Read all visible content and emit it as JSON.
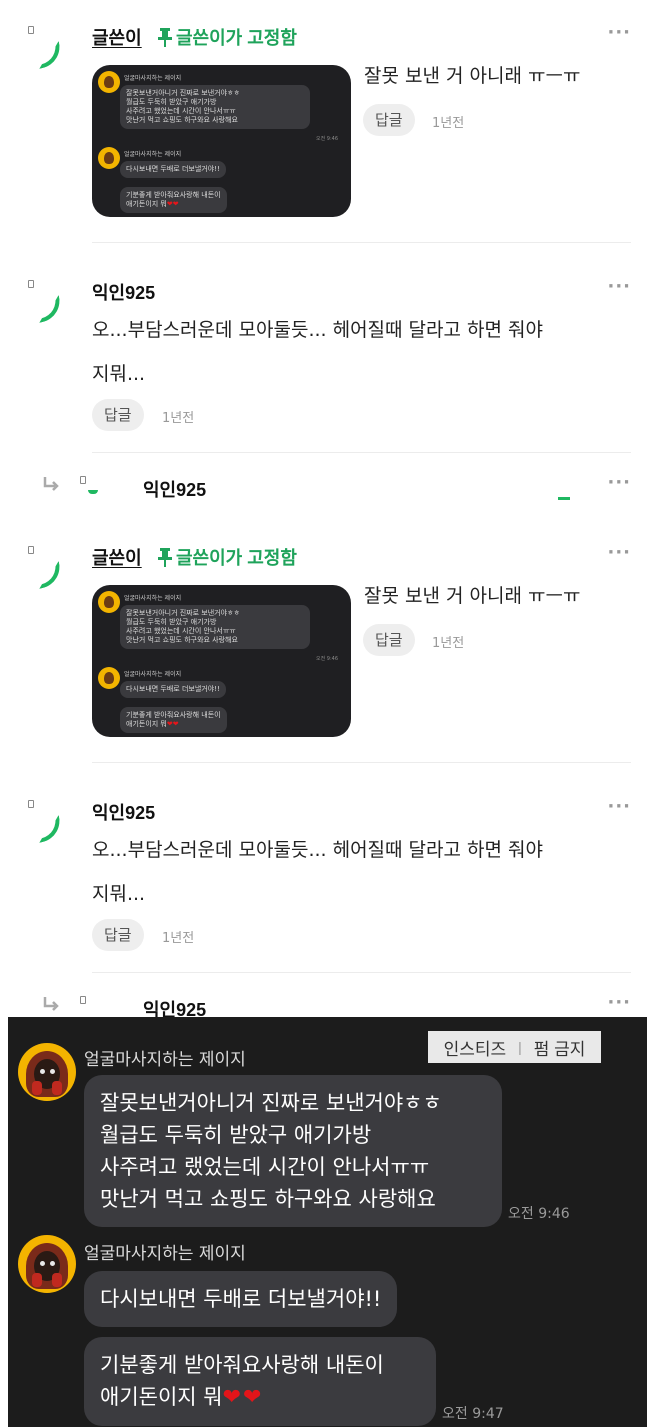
{
  "comment_blocks": [
    {
      "pinned": {
        "author": "글쓴이",
        "pin_label": "글쓴이가 고정함",
        "text": "잘못 보낸 거 아니래 ㅠㅡㅠ",
        "reply_label": "답글",
        "time": "1년전",
        "more": "···"
      },
      "comment": {
        "author": "익인925",
        "text_line1": "오...부담스러운데 모아둘듯... 헤어질때 달라고 하면 줘야",
        "text_line2": "지뭐...",
        "reply_label": "답글",
        "time": "1년전",
        "more": "···"
      },
      "nested": {
        "author": "익인925",
        "more": "···"
      }
    },
    {
      "pinned": {
        "author": "글쓴이",
        "pin_label": "글쓴이가 고정함",
        "text": "잘못 보낸 거 아니래 ㅠㅡㅠ",
        "reply_label": "답글",
        "time": "1년전",
        "more": "···"
      },
      "comment": {
        "author": "익인925",
        "text_line1": "오...부담스러운데 모아둘듯... 헤어질때 달라고 하면 줘야",
        "text_line2": "지뭐...",
        "reply_label": "답글",
        "time": "1년전",
        "more": "···"
      },
      "nested": {
        "author": "익인925",
        "more": "···"
      }
    }
  ],
  "chat": {
    "tag_left": "인스티즈",
    "tag_sep": "|",
    "tag_right": "펌 금지",
    "groups": [
      {
        "sender": "얼굴마사지하는 제이지",
        "messages": [
          {
            "lines": [
              "잘못보낸거아니거 진짜로 보낸거야ㅎㅎ",
              "월급도 두둑히 받았구 애기가방",
              "사주려고 랬었는데 시간이 안나서ㅠㅠ",
              "맛난거 먹고 쇼핑도 하구와요 사랑해요"
            ],
            "time": "오전 9:46"
          }
        ]
      },
      {
        "sender": "얼굴마사지하는 제이지",
        "messages": [
          {
            "lines": [
              "다시보내면 두배로 더보낼거야!!"
            ],
            "time": ""
          },
          {
            "lines": [
              "기분좋게 받아줘요사랑해 내돈이",
              "애기돈이지 뭐"
            ],
            "hearts": "❤❤",
            "time": "오전 9:47"
          }
        ]
      }
    ]
  },
  "colors": {
    "accent_green": "#1fa35b",
    "chat_bg": "#1c1c1c",
    "bubble": "#3b3b3f",
    "heart": "#e3151a"
  },
  "icons": [
    "pin-icon",
    "more-icon",
    "reply-arrow-icon"
  ]
}
